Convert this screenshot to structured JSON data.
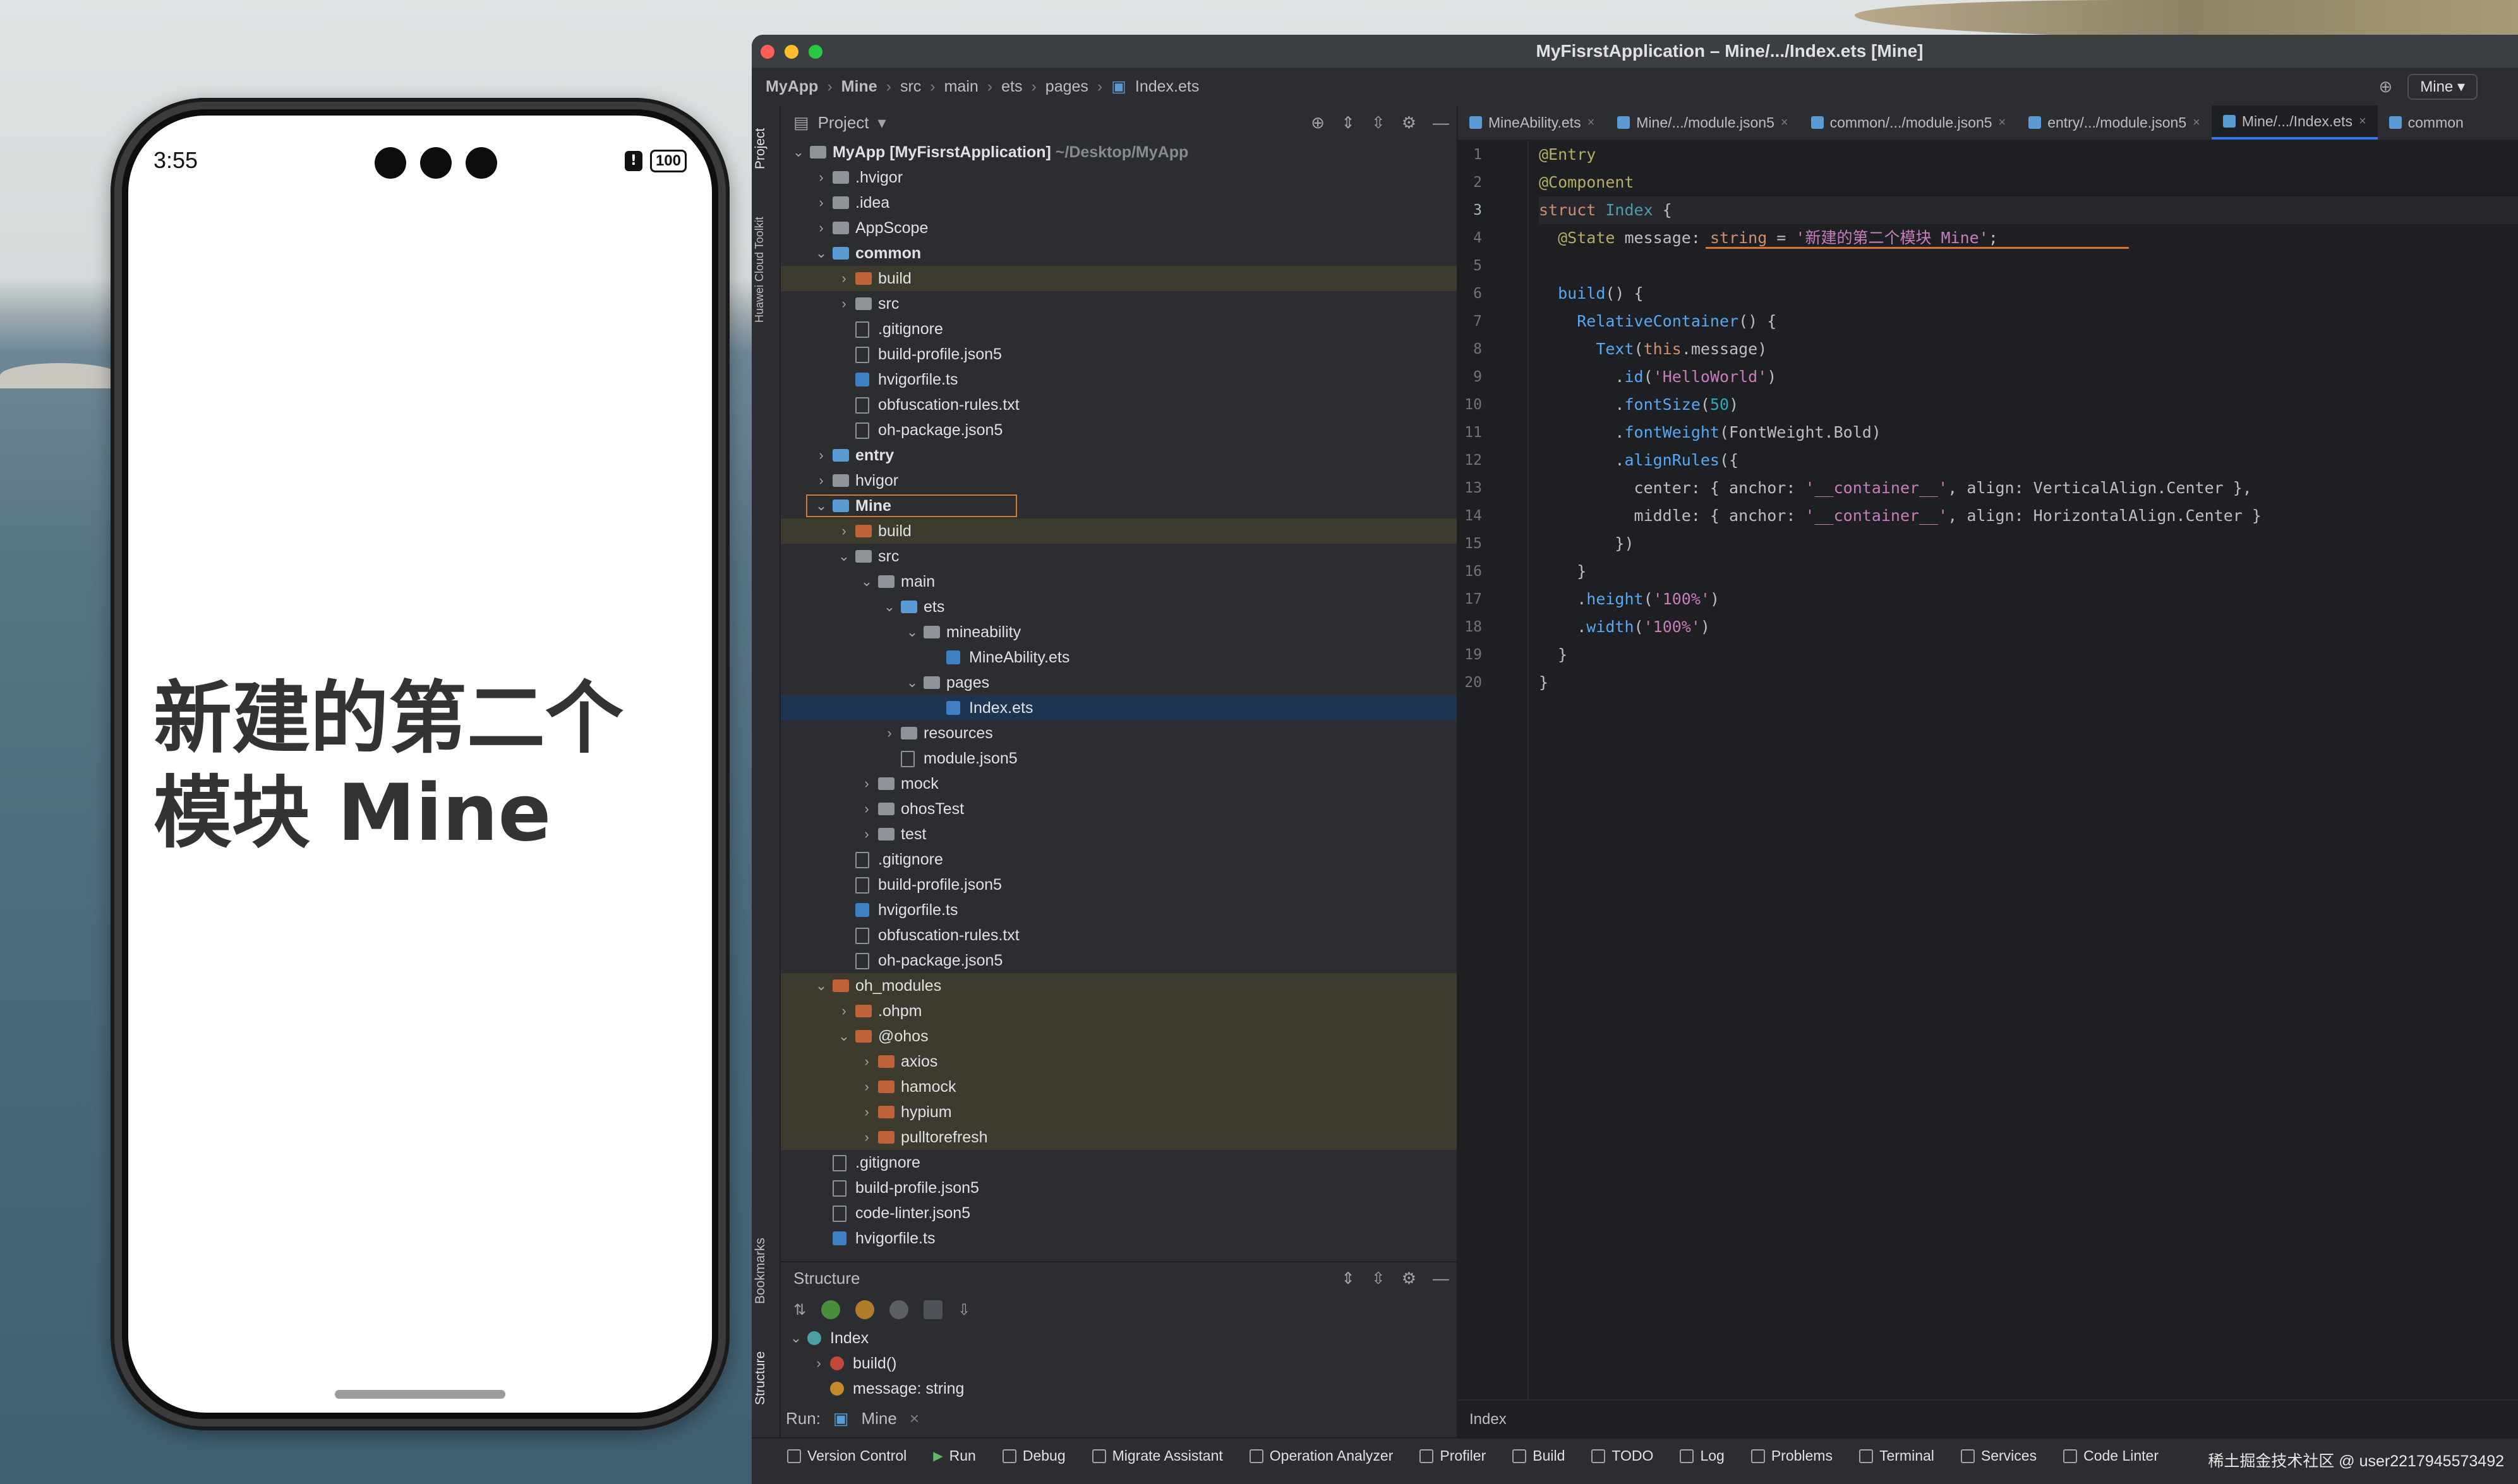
{
  "phone": {
    "time": "3:55",
    "battery": "100",
    "notification_glyph": "!",
    "message": "新建的第二个模块 Mine"
  },
  "window": {
    "title": "MyFisrstApplication – Mine/.../Index.ets [Mine]",
    "breadcrumbs": [
      "MyApp",
      "Mine",
      "src",
      "main",
      "ets",
      "pages",
      "Index.ets"
    ],
    "run_config": "Mine"
  },
  "side_tabs": {
    "project": "Project",
    "cloud": "Huawei Cloud Toolkit",
    "bookmarks": "Bookmarks",
    "structure": "Structure"
  },
  "project_panel": {
    "title": "Project",
    "tree": [
      {
        "label": "MyApp",
        "extra": "[MyFisrstApplication]",
        "path": "~/Desktop/MyApp",
        "depth": 0,
        "arrow": "open",
        "icon": "folder",
        "bold": true
      },
      {
        "label": ".hvigor",
        "depth": 1,
        "arrow": "closed",
        "icon": "folder"
      },
      {
        "label": ".idea",
        "depth": 1,
        "arrow": "closed",
        "icon": "folder"
      },
      {
        "label": "AppScope",
        "depth": 1,
        "arrow": "closed",
        "icon": "folder"
      },
      {
        "label": "common",
        "depth": 1,
        "arrow": "open",
        "icon": "folder-b",
        "bold": true
      },
      {
        "label": "build",
        "depth": 2,
        "arrow": "closed",
        "icon": "folder-o",
        "hl": true
      },
      {
        "label": "src",
        "depth": 2,
        "arrow": "closed",
        "icon": "folder"
      },
      {
        "label": ".gitignore",
        "depth": 2,
        "icon": "file"
      },
      {
        "label": "build-profile.json5",
        "depth": 2,
        "icon": "file"
      },
      {
        "label": "hvigorfile.ts",
        "depth": 2,
        "icon": "ts"
      },
      {
        "label": "obfuscation-rules.txt",
        "depth": 2,
        "icon": "file"
      },
      {
        "label": "oh-package.json5",
        "depth": 2,
        "icon": "file"
      },
      {
        "label": "entry",
        "depth": 1,
        "arrow": "closed",
        "icon": "folder-b",
        "bold": true
      },
      {
        "label": "hvigor",
        "depth": 1,
        "arrow": "closed",
        "icon": "folder"
      },
      {
        "label": "Mine",
        "depth": 1,
        "arrow": "open",
        "icon": "folder-b",
        "bold": true,
        "focus": true
      },
      {
        "label": "build",
        "depth": 2,
        "arrow": "closed",
        "icon": "folder-o",
        "hl": true
      },
      {
        "label": "src",
        "depth": 2,
        "arrow": "open",
        "icon": "folder"
      },
      {
        "label": "main",
        "depth": 3,
        "arrow": "open",
        "icon": "folder"
      },
      {
        "label": "ets",
        "depth": 4,
        "arrow": "open",
        "icon": "folder-b"
      },
      {
        "label": "mineability",
        "depth": 5,
        "arrow": "open",
        "icon": "folder"
      },
      {
        "label": "MineAbility.ets",
        "depth": 6,
        "icon": "ts"
      },
      {
        "label": "pages",
        "depth": 5,
        "arrow": "open",
        "icon": "folder"
      },
      {
        "label": "Index.ets",
        "depth": 6,
        "icon": "ts",
        "sel": true
      },
      {
        "label": "resources",
        "depth": 4,
        "arrow": "closed",
        "icon": "folder"
      },
      {
        "label": "module.json5",
        "depth": 4,
        "icon": "file"
      },
      {
        "label": "mock",
        "depth": 3,
        "arrow": "closed",
        "icon": "folder"
      },
      {
        "label": "ohosTest",
        "depth": 3,
        "arrow": "closed",
        "icon": "folder"
      },
      {
        "label": "test",
        "depth": 3,
        "arrow": "closed",
        "icon": "folder"
      },
      {
        "label": ".gitignore",
        "depth": 2,
        "icon": "file"
      },
      {
        "label": "build-profile.json5",
        "depth": 2,
        "icon": "file"
      },
      {
        "label": "hvigorfile.ts",
        "depth": 2,
        "icon": "ts"
      },
      {
        "label": "obfuscation-rules.txt",
        "depth": 2,
        "icon": "file"
      },
      {
        "label": "oh-package.json5",
        "depth": 2,
        "icon": "file"
      },
      {
        "label": "oh_modules",
        "depth": 1,
        "arrow": "open",
        "icon": "folder-o",
        "hl": true
      },
      {
        "label": ".ohpm",
        "depth": 2,
        "arrow": "closed",
        "icon": "folder-o",
        "hl": true
      },
      {
        "label": "@ohos",
        "depth": 2,
        "arrow": "open",
        "icon": "folder-o",
        "hl": true
      },
      {
        "label": "axios",
        "depth": 3,
        "arrow": "closed",
        "icon": "folder-o",
        "hl": true
      },
      {
        "label": "hamock",
        "depth": 3,
        "arrow": "closed",
        "icon": "folder-o",
        "hl": true
      },
      {
        "label": "hypium",
        "depth": 3,
        "arrow": "closed",
        "icon": "folder-o",
        "hl": true
      },
      {
        "label": "pulltorefresh",
        "depth": 3,
        "arrow": "closed",
        "icon": "folder-o",
        "hl": true
      },
      {
        "label": ".gitignore",
        "depth": 1,
        "icon": "file"
      },
      {
        "label": "build-profile.json5",
        "depth": 1,
        "icon": "file"
      },
      {
        "label": "code-linter.json5",
        "depth": 1,
        "icon": "file"
      },
      {
        "label": "hvigorfile.ts",
        "depth": 1,
        "icon": "ts"
      }
    ]
  },
  "structure_panel": {
    "title": "Structure",
    "items": [
      {
        "label": "Index",
        "depth": 0,
        "arrow": "open"
      },
      {
        "label": "build()",
        "depth": 1,
        "arrow": "closed"
      },
      {
        "label": "message: string",
        "depth": 1
      }
    ]
  },
  "editor": {
    "tabs": [
      {
        "label": "MineAbility.ets",
        "active": false
      },
      {
        "label": "Mine/.../module.json5",
        "active": false
      },
      {
        "label": "common/.../module.json5",
        "active": false
      },
      {
        "label": "entry/.../module.json5",
        "active": false
      },
      {
        "label": "Mine/.../Index.ets",
        "active": true
      },
      {
        "label": "common",
        "active": false
      }
    ],
    "current_line": 3,
    "code": [
      [
        {
          "t": "@Entry",
          "c": "an"
        }
      ],
      [
        {
          "t": "@Component",
          "c": "an"
        }
      ],
      [
        {
          "t": "struct ",
          "c": "kw"
        },
        {
          "t": "Index ",
          "c": "cls"
        },
        {
          "t": "{",
          "c": ""
        }
      ],
      [
        {
          "t": "  ",
          "c": ""
        },
        {
          "t": "@State ",
          "c": "an"
        },
        {
          "t": "message",
          "c": ""
        },
        {
          "t": ": ",
          "c": ""
        },
        {
          "t": "string",
          "c": "kw"
        },
        {
          "t": " = ",
          "c": ""
        },
        {
          "t": "'新建的第二个模块 Mine'",
          "c": "str2"
        },
        {
          "t": ";",
          "c": ""
        }
      ],
      [],
      [
        {
          "t": "  ",
          "c": ""
        },
        {
          "t": "build",
          "c": "fn"
        },
        {
          "t": "() {",
          "c": ""
        }
      ],
      [
        {
          "t": "    ",
          "c": ""
        },
        {
          "t": "RelativeContainer",
          "c": "fn"
        },
        {
          "t": "() {",
          "c": ""
        }
      ],
      [
        {
          "t": "      ",
          "c": ""
        },
        {
          "t": "Text",
          "c": "fn"
        },
        {
          "t": "(",
          "c": ""
        },
        {
          "t": "this",
          "c": "kw"
        },
        {
          "t": ".message)",
          "c": ""
        }
      ],
      [
        {
          "t": "        .",
          "c": ""
        },
        {
          "t": "id",
          "c": "fn"
        },
        {
          "t": "(",
          "c": ""
        },
        {
          "t": "'HelloWorld'",
          "c": "str2"
        },
        {
          "t": ")",
          "c": ""
        }
      ],
      [
        {
          "t": "        .",
          "c": ""
        },
        {
          "t": "fontSize",
          "c": "fn"
        },
        {
          "t": "(",
          "c": ""
        },
        {
          "t": "50",
          "c": "nm"
        },
        {
          "t": ")",
          "c": ""
        }
      ],
      [
        {
          "t": "        .",
          "c": ""
        },
        {
          "t": "fontWeight",
          "c": "fn"
        },
        {
          "t": "(FontWeight.Bold)",
          "c": ""
        }
      ],
      [
        {
          "t": "        .",
          "c": ""
        },
        {
          "t": "alignRules",
          "c": "fn"
        },
        {
          "t": "({",
          "c": ""
        }
      ],
      [
        {
          "t": "          center: { anchor: ",
          "c": ""
        },
        {
          "t": "'__container__'",
          "c": "str2"
        },
        {
          "t": ", align: VerticalAlign.Center },",
          "c": ""
        }
      ],
      [
        {
          "t": "          middle: { anchor: ",
          "c": ""
        },
        {
          "t": "'__container__'",
          "c": "str2"
        },
        {
          "t": ", align: HorizontalAlign.Center }",
          "c": ""
        }
      ],
      [
        {
          "t": "        })",
          "c": ""
        }
      ],
      [
        {
          "t": "    }",
          "c": ""
        }
      ],
      [
        {
          "t": "    .",
          "c": ""
        },
        {
          "t": "height",
          "c": "fn"
        },
        {
          "t": "(",
          "c": ""
        },
        {
          "t": "'100%'",
          "c": "str2"
        },
        {
          "t": ")",
          "c": ""
        }
      ],
      [
        {
          "t": "    .",
          "c": ""
        },
        {
          "t": "width",
          "c": "fn"
        },
        {
          "t": "(",
          "c": ""
        },
        {
          "t": "'100%'",
          "c": "str2"
        },
        {
          "t": ")",
          "c": ""
        }
      ],
      [
        {
          "t": "  }",
          "c": ""
        }
      ],
      [
        {
          "t": "}",
          "c": ""
        }
      ]
    ],
    "footer_crumb": "Index"
  },
  "run": {
    "label": "Run:",
    "config": "Mine"
  },
  "bottom_tools": [
    "Version Control",
    "Run",
    "Debug",
    "Migrate Assistant",
    "Operation Analyzer",
    "Profiler",
    "Build",
    "TODO",
    "Log",
    "Problems",
    "Terminal",
    "Services",
    "Code Linter"
  ],
  "watermark": "稀土掘金技术社区 @ user2217945573492",
  "colors": {
    "accent": "#3574f0",
    "ide_bg": "#2b2d30",
    "editor_bg": "#1e1f22",
    "highlight_row": "#3d3a2e",
    "selected_row": "#1e3551",
    "focus_border": "#d9762b"
  }
}
